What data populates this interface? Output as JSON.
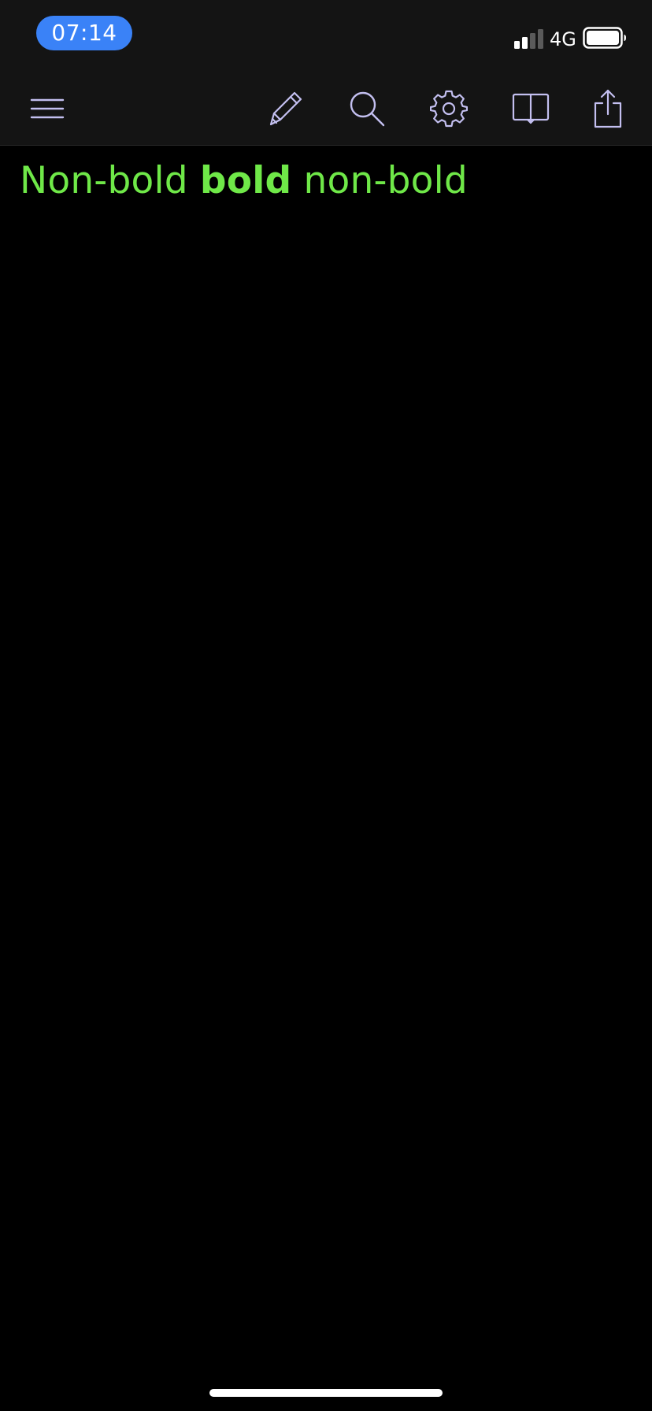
{
  "status_bar": {
    "time": "07:14",
    "network": "4G"
  },
  "toolbar": {
    "items": [
      {
        "name": "menu",
        "icon": "hamburger-menu-icon"
      },
      {
        "name": "edit",
        "icon": "pencil-icon"
      },
      {
        "name": "search",
        "icon": "search-icon"
      },
      {
        "name": "settings",
        "icon": "gear-icon"
      },
      {
        "name": "preview",
        "icon": "book-icon"
      },
      {
        "name": "share",
        "icon": "share-icon"
      }
    ]
  },
  "editor": {
    "segments": [
      {
        "text": "Non-bold ",
        "bold": false
      },
      {
        "text": "bold",
        "bold": true
      },
      {
        "text": " non-bold",
        "bold": false
      }
    ]
  },
  "colors": {
    "time_pill": "#3a82f7",
    "bar_background": "#141414",
    "icon": "#c3bff0",
    "text": "#6fe848",
    "background": "#000000"
  }
}
